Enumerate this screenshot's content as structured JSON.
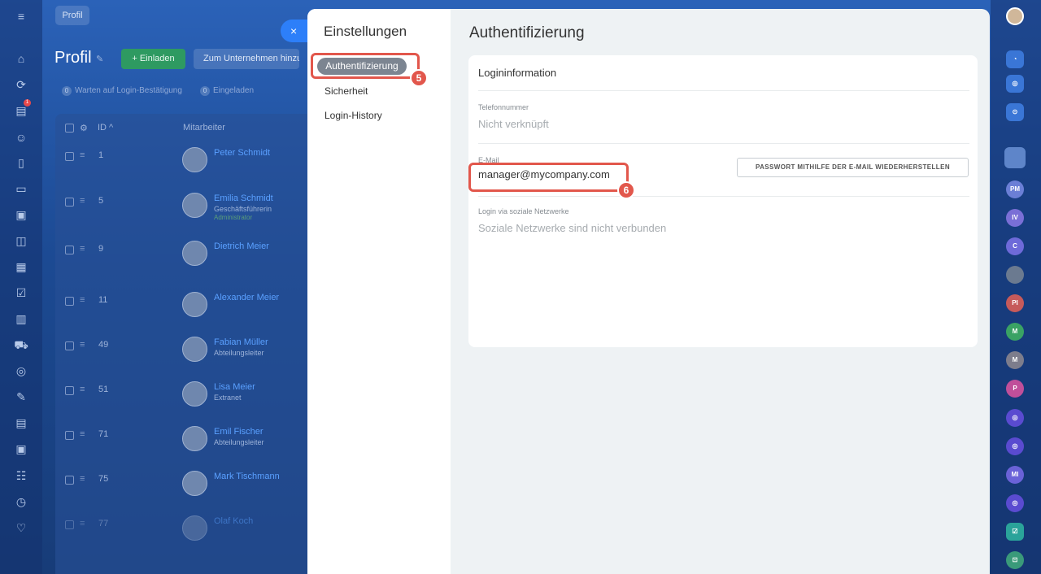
{
  "background_page": {
    "breadcrumb": "Profil",
    "title": "Profil",
    "invite_button": "+ Einladen",
    "add_company_button": "Zum Unternehmen hinzufügen",
    "stats": [
      {
        "count": "0",
        "label": "Warten auf Login-Bestätigung"
      },
      {
        "count": "0",
        "label": "Eingeladen"
      }
    ],
    "grid": {
      "col_id": "ID ^",
      "col_employee": "Mitarbeiter",
      "rows": [
        {
          "id": "1",
          "name": "Peter Schmidt",
          "role": "",
          "tag": ""
        },
        {
          "id": "5",
          "name": "Emilia Schmidt",
          "role": "Geschäftsführerin",
          "tag": "Administrator"
        },
        {
          "id": "9",
          "name": "Dietrich Meier",
          "role": "",
          "tag": ""
        },
        {
          "id": "11",
          "name": "Alexander Meier",
          "role": "",
          "tag": ""
        },
        {
          "id": "49",
          "name": "Fabian Müller",
          "role": "Abteilungsleiter",
          "tag": ""
        },
        {
          "id": "51",
          "name": "Lisa Meier",
          "role": "Extranet",
          "tag": ""
        },
        {
          "id": "71",
          "name": "Emil Fischer",
          "role": "Abteilungsleiter",
          "tag": ""
        },
        {
          "id": "75",
          "name": "Mark Tischmann",
          "role": "",
          "tag": ""
        },
        {
          "id": "77",
          "name": "Olaf Koch",
          "role": "",
          "tag": ""
        }
      ]
    }
  },
  "close_button": "×",
  "settings": {
    "sidebar_title": "Einstellungen",
    "nav": [
      "Authentifizierung",
      "Sicherheit",
      "Login-History"
    ],
    "main_title": "Authentifizierung",
    "card": {
      "title": "Logininformation",
      "phone_label": "Telefonnummer",
      "phone_value": "Nicht verknüpft",
      "email_label": "E-Mail",
      "email_value": "manager@mycompany.com",
      "reset_button": "PASSWORT MITHILFE DER E-MAIL WIEDERHERSTELLEN",
      "social_label": "Login via soziale Netzwerke",
      "social_value": "Soziale Netzwerke sind nicht verbunden"
    }
  },
  "annotations": {
    "marker_nav": "5",
    "marker_email": "6"
  },
  "right_rail_avatars": [
    "PM",
    "IV",
    "C",
    "PI",
    "M",
    "M",
    "P",
    "MI"
  ],
  "colors": {
    "accent_blue": "#2d7ff9",
    "annotation_red": "#e2574c",
    "nav_active": "#7c8591"
  }
}
